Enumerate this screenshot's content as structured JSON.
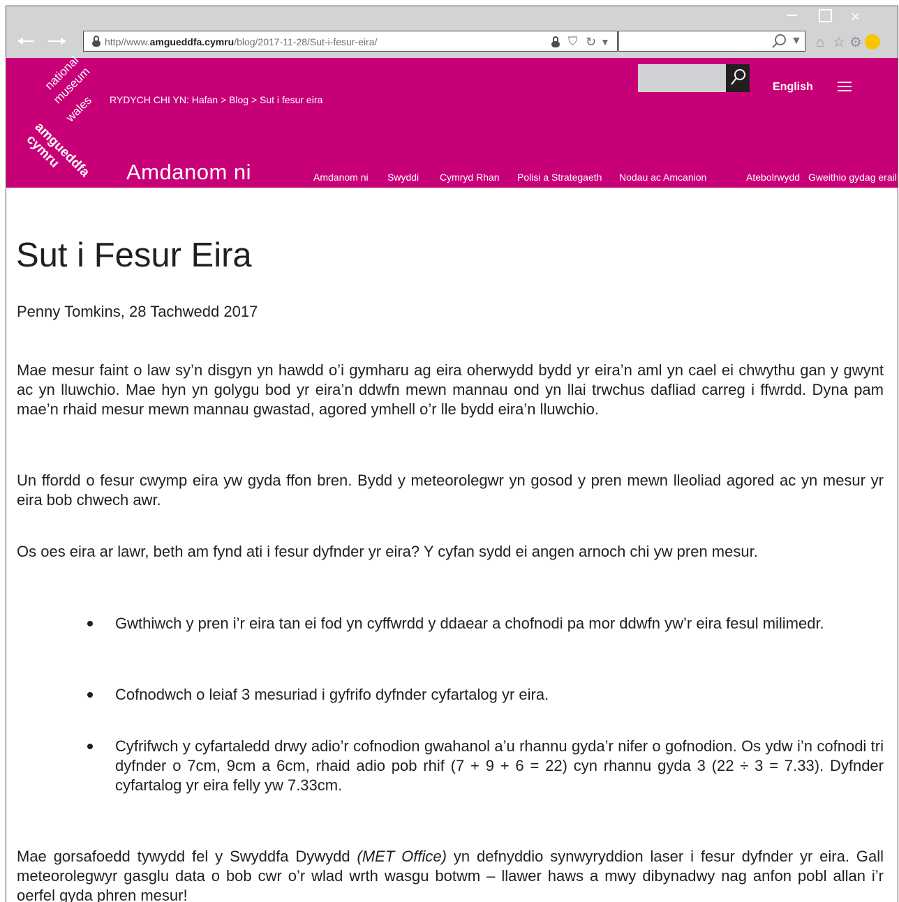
{
  "browser": {
    "url_prefix": "http//www.",
    "url_domain": "amgueddfa.cymru",
    "url_path": "/blog/2017-11-28/Sut-i-fesur-eira/"
  },
  "header": {
    "logo_lines": [
      "national",
      "museum",
      "wales",
      "amgueddfa",
      "cymru"
    ],
    "breadcrumb": "RYDYCH CHI YN: Hafan > Blog > Sut i fesur eira",
    "section_title": "Amdanom ni",
    "language_link": "English",
    "nav": [
      "Amdanom ni",
      "Swyddi",
      "Cymryd Rhan",
      "Polisi a Strategaeth",
      "Nodau ac Amcanion",
      "Atebolrwydd",
      "Gweithio gydag eraill"
    ],
    "colors": {
      "brand": "#c80078",
      "chrome": "#d2d3d5"
    }
  },
  "article": {
    "title": "Sut i Fesur Eira",
    "byline": "Penny Tomkins, 28 Tachwedd 2017",
    "p1": "Mae mesur faint o law sy’n disgyn yn hawdd o’i gymharu ag eira oherwydd bydd yr eira’n aml yn cael ei chwythu gan y gwynt ac yn lluwchio. Mae hyn yn golygu bod yr eira’n ddwfn mewn mannau ond yn llai trwchus dafliad carreg i ffwrdd. Dyna pam mae’n rhaid mesur mewn mannau gwastad, agored ymhell o’r lle bydd eira’n lluwchio.",
    "p2": "Un ffordd o fesur cwymp eira yw gyda ffon bren. Bydd y meteorolegwr yn gosod y pren mewn lleoliad agored ac yn mesur yr eira bob chwech awr.",
    "p3": "Os oes eira ar lawr, beth am fynd ati i fesur dyfnder yr eira? Y cyfan sydd ei angen arnoch chi yw pren mesur.",
    "bullets": [
      "Gwthiwch y pren i’r eira tan ei fod yn cyffwrdd y ddaear a chofnodi pa mor ddwfn yw’r eira fesul milimedr.",
      "Cofnodwch o leiaf 3 mesuriad i gyfrifo dyfnder cyfartalog yr eira.",
      "Cyfrifwch y cyfartaledd drwy adio’r cofnodion gwahanol a’u rhannu gyda’r nifer o gofnodion. Os ydw i’n cofnodi tri dyfnder o 7cm, 9cm a 6cm, rhaid adio pob rhif (7 + 9 + 6 = 22) cyn rhannu gyda 3 (22 ÷ 3 = 7.33). Dyfnder cyfartalog yr eira felly yw 7.33cm."
    ],
    "p4_before": "Mae gorsafoedd tywydd fel y Swyddfa Dywydd ",
    "p4_italic": "(MET Office)",
    "p4_after": " yn defnyddio synwyryddion laser i fesur dyfnder yr eira. Gall meteorolegwyr gasglu data o bob cwr o’r wlad wrth wasgu botwm – llawer haws a mwy dibynadwy nag anfon pobl allan i’r oerfel gyda phren mesur!"
  }
}
